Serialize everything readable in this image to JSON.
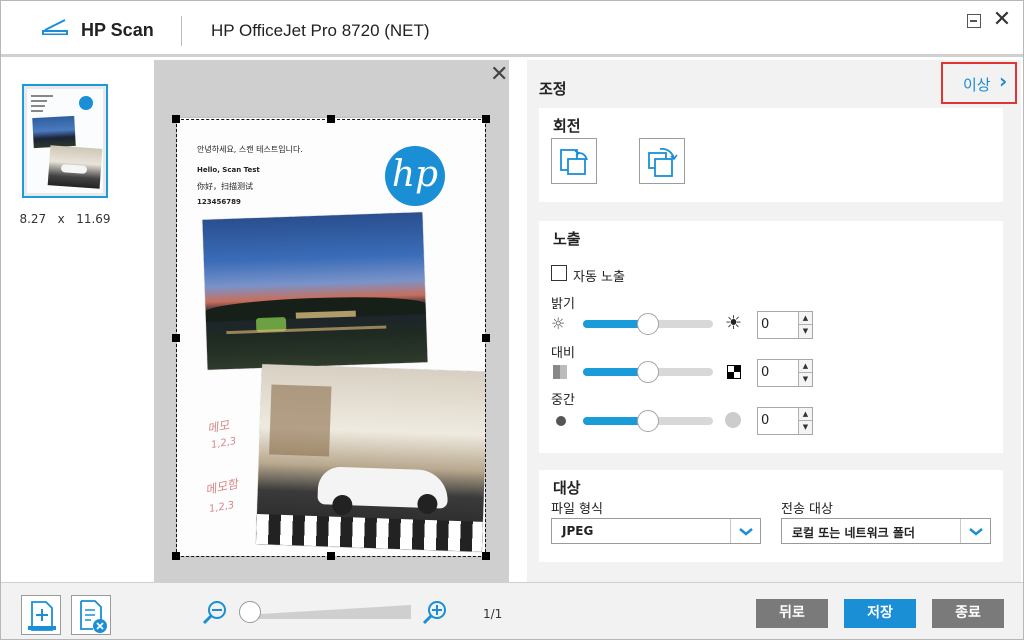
{
  "header": {
    "app_title": "HP Scan",
    "device_name": "HP OfficeJet Pro 8720 (NET)",
    "logo_icon": "scanner-icon",
    "minimize_icon": "minimize-icon",
    "close_icon": "close-icon"
  },
  "thumbnail": {
    "size_width": "8.27",
    "size_sep": "x",
    "size_height": "11.69",
    "accent_color": "#1a9cd8"
  },
  "preview": {
    "close_icon": "close-icon",
    "page_text": [
      "안녕하세요, 스캔 테스트입니다.",
      "Hello, Scan Test",
      "你好，扫描测试",
      "123456789"
    ],
    "logo_text": "hp",
    "handwriting": [
      "메모",
      "1,2,3",
      "메모함",
      "1,2,3"
    ]
  },
  "adjust": {
    "title": "조정",
    "more_label": "이상",
    "more_icon": "chevron-right-icon",
    "highlight_color": "#e03535"
  },
  "rotate": {
    "title": "회전",
    "left_icon": "rotate-left-icon",
    "right_icon": "rotate-right-icon"
  },
  "exposure": {
    "title": "노출",
    "auto_label": "자동 노출",
    "auto_checked": false,
    "brightness": {
      "label": "밝기",
      "value": "0",
      "level": 0.5
    },
    "contrast": {
      "label": "대비",
      "value": "0",
      "level": 0.5
    },
    "midtone": {
      "label": "중간",
      "value": "0",
      "level": 0.5
    },
    "slider_color": "#1a9cd8"
  },
  "destination": {
    "title": "대상",
    "file_type_label": "파일 형식",
    "file_type_value": "JPEG",
    "send_to_label": "전송 대상",
    "send_to_value": "로컬 또는 네트워크 폴더",
    "dropdown_icon": "chevron-down-icon"
  },
  "footer": {
    "add_page_icon": "add-page-icon",
    "delete_page_icon": "delete-page-icon",
    "zoom_out_icon": "zoom-out-icon",
    "zoom_in_icon": "zoom-in-icon",
    "zoom_level": 0,
    "page_count": "1/1",
    "back_label": "뒤로",
    "save_label": "저장",
    "exit_label": "종료",
    "back_color": "#7a7a7a",
    "save_color": "#1a8fd6",
    "exit_color": "#7a7a7a"
  }
}
